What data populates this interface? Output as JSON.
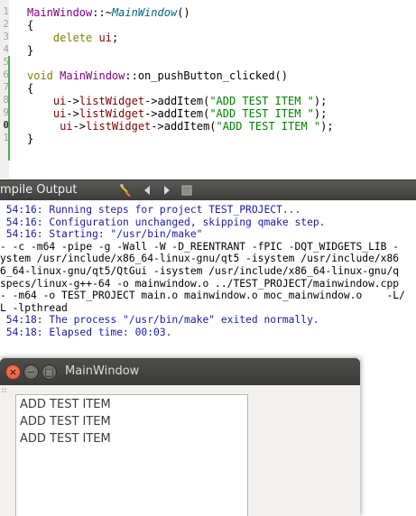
{
  "editor": {
    "line_numbers": [
      "1",
      "2",
      "3",
      "4",
      "5",
      "6",
      "7",
      "8",
      "9",
      "0",
      "1"
    ],
    "lines": [
      {
        "parts": [
          {
            "c": "cls",
            "t": "MainWindow"
          },
          {
            "c": "punc",
            "t": "::~"
          },
          {
            "c": "fn-it",
            "t": "MainWindow"
          },
          {
            "c": "punc",
            "t": "()"
          }
        ]
      },
      {
        "parts": [
          {
            "c": "punc",
            "t": "{"
          }
        ]
      },
      {
        "parts": [
          {
            "c": "kw",
            "t": "    delete "
          },
          {
            "c": "mem",
            "t": "ui"
          },
          {
            "c": "punc",
            "t": ";"
          }
        ]
      },
      {
        "parts": [
          {
            "c": "punc",
            "t": "}"
          }
        ]
      },
      {
        "parts": []
      },
      {
        "parts": [
          {
            "c": "kw",
            "t": "void "
          },
          {
            "c": "cls",
            "t": "MainWindow"
          },
          {
            "c": "punc",
            "t": "::on_pushButton_clicked()"
          }
        ]
      },
      {
        "parts": [
          {
            "c": "punc",
            "t": "{"
          }
        ]
      },
      {
        "parts": [
          {
            "c": "mem",
            "t": "    ui"
          },
          {
            "c": "punc",
            "t": "->"
          },
          {
            "c": "mem",
            "t": "listWidget"
          },
          {
            "c": "punc",
            "t": "->addItem("
          },
          {
            "c": "str",
            "t": "\"ADD TEST ITEM \""
          },
          {
            "c": "punc",
            "t": ");"
          }
        ]
      },
      {
        "parts": [
          {
            "c": "mem",
            "t": "    ui"
          },
          {
            "c": "punc",
            "t": "->"
          },
          {
            "c": "mem",
            "t": "listWidget"
          },
          {
            "c": "punc",
            "t": "->addItem("
          },
          {
            "c": "str",
            "t": "\"ADD TEST ITEM \""
          },
          {
            "c": "punc",
            "t": ");"
          }
        ]
      },
      {
        "parts": [
          {
            "c": "mem",
            "t": "     ui"
          },
          {
            "c": "punc",
            "t": "->"
          },
          {
            "c": "mem",
            "t": "listWidget"
          },
          {
            "c": "punc",
            "t": "->addItem("
          },
          {
            "c": "str",
            "t": "\"ADD TEST ITEM \""
          },
          {
            "c": "punc",
            "t": ");"
          }
        ]
      },
      {
        "parts": [
          {
            "c": "punc",
            "t": "}"
          }
        ]
      }
    ]
  },
  "compile_output": {
    "title": "mpile Output",
    "toolbar_icons": [
      "clean-icon",
      "prev-icon",
      "next-icon",
      "stop-icon"
    ],
    "lines": [
      {
        "style": "blue",
        "text": " 54:16: Running steps for project TEST_PROJECT..."
      },
      {
        "style": "blue",
        "text": " 54:16: Configuration unchanged, skipping qmake step."
      },
      {
        "style": "blue",
        "text": " 54:16: Starting: \"/usr/bin/make\""
      },
      {
        "style": "black",
        "text": "- -c -m64 -pipe -g -Wall -W -D_REENTRANT -fPIC -DQT_WIDGETS_LIB -"
      },
      {
        "style": "black",
        "text": "ystem /usr/include/x86_64-linux-gnu/qt5 -isystem /usr/include/x86"
      },
      {
        "style": "black",
        "text": "6_64-linux-gnu/qt5/QtGui -isystem /usr/include/x86_64-linux-gnu/q"
      },
      {
        "style": "black",
        "text": "specs/linux-g++-64 -o mainwindow.o ../TEST_PROJECT/mainwindow.cpp"
      },
      {
        "style": "black",
        "text": "- -m64 -o TEST_PROJECT main.o mainwindow.o moc_mainwindow.o    -L/"
      },
      {
        "style": "black",
        "text": "L -lpthread"
      },
      {
        "style": "blue",
        "text": " 54:18: The process \"/usr/bin/make\" exited normally."
      },
      {
        "style": "blue",
        "text": " 54:18: Elapsed time: 00:03."
      }
    ]
  },
  "main_window": {
    "title": "MainWindow",
    "close_glyph": "×",
    "min_glyph": "−",
    "max_glyph": "□",
    "list_items": [
      "ADD TEST ITEM",
      "ADD TEST ITEM",
      "ADD TEST ITEM"
    ]
  },
  "colors": {
    "pane_header": "#4a4a48",
    "output_blue": "#1a1aa6",
    "close_button": "#e95c3e",
    "change_bar": "#4caf50"
  }
}
